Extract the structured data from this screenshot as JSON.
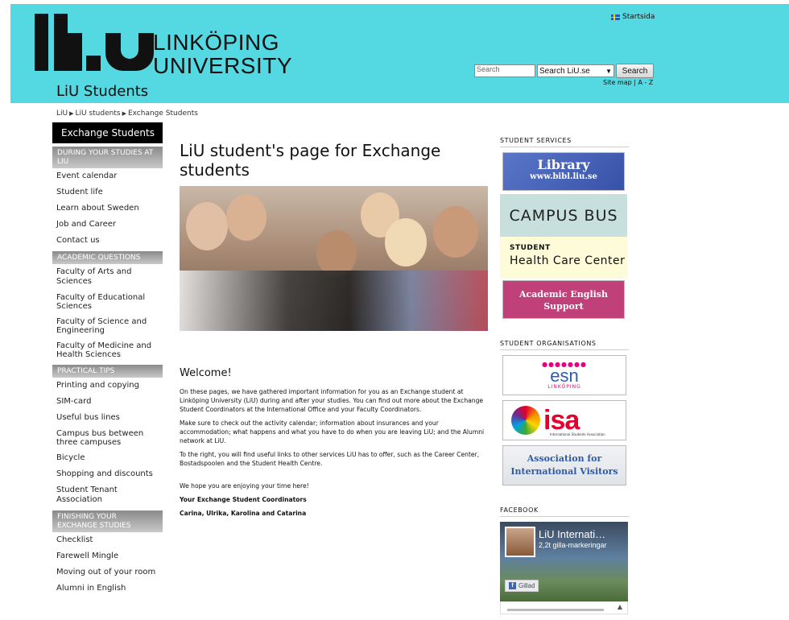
{
  "header": {
    "logo_line1": "LINKÖPING",
    "logo_line2": "UNIVERSITY",
    "site_name": "LiU Students",
    "startsida_label": "Startsida",
    "search_placeholder": "Search",
    "search_scope": "Search LiU.se",
    "search_button": "Search",
    "sitemap_label": "Site map | A - Z",
    "accent_color": "#54d9e3"
  },
  "breadcrumb": [
    "LiU",
    "LiU students",
    "Exchange Students"
  ],
  "leftnav": {
    "title": "Exchange Students",
    "sections": [
      {
        "heading": "DURING YOUR STUDIES AT LIU",
        "items": [
          "Event calendar",
          "Student life",
          "Learn about Sweden",
          "Job and Career",
          "Contact us"
        ]
      },
      {
        "heading": "ACADEMIC QUESTIONS",
        "items": [
          "Faculty of Arts and Sciences",
          "Faculty of Educational Sciences",
          "Faculty of Science and Engineering",
          "Faculty of Medicine and Health Sciences"
        ]
      },
      {
        "heading": "PRACTICAL TIPS",
        "items": [
          "Printing and copying",
          "SIM-card",
          "Useful bus lines",
          "Campus bus between three campuses",
          "Bicycle",
          "Shopping and discounts",
          "Student Tenant Association"
        ]
      },
      {
        "heading": "FINISHING YOUR EXCHANGE STUDIES",
        "items": [
          "Checklist",
          "Farewell Mingle",
          "Moving out of your room",
          "Alumni in English"
        ]
      }
    ]
  },
  "main": {
    "title": "LiU student's page for Exchange students",
    "welcome_heading": "Welcome!",
    "paragraphs": [
      "On these pages, we have gathered important information for you as an Exchange student at Linköping University (LiU) during and after your studies. You can find out more about the Exchange Student Coordinators at the International Office and your Faculty Coordinators.",
      "Make sure to check out the activity calendar; information about insurances and your accommodation; what happens and what you have to do when you are leaving LiU; and the Alumni network at LiU.",
      "To the right, you will find useful links to other services LiU has to offer, such as the Career Center, Bostadspoolen and the Student Health Centre."
    ],
    "closing": "We hope you are enjoying your time here!",
    "signature_title": "Your Exchange Student Coordinators",
    "signature_names": "Carina, Ulrika, Karolina and Catarina"
  },
  "right": {
    "services_heading": "STUDENT SERVICES",
    "library_title": "Library",
    "library_url": "www.bibl.liu.se",
    "campus_bus": "CAMPUS BUS",
    "health_line1": "STUDENT",
    "health_line2": "Health Care Center",
    "academic_english_line1": "Academic English",
    "academic_english_line2": "Support",
    "orgs_heading": "STUDENT ORGANISATIONS",
    "esn_word": "esn",
    "esn_city": "LINKÖPING",
    "isa_word": "isa",
    "isa_sub": "International Students Association",
    "aiv_line1": "Association for",
    "aiv_line2": "International Visitors",
    "facebook_heading": "FACEBOOK",
    "fb_page_name": "LiU Internati…",
    "fb_likes": "2,2t gilla-markeringar",
    "fb_liked_label": "Gillad"
  }
}
